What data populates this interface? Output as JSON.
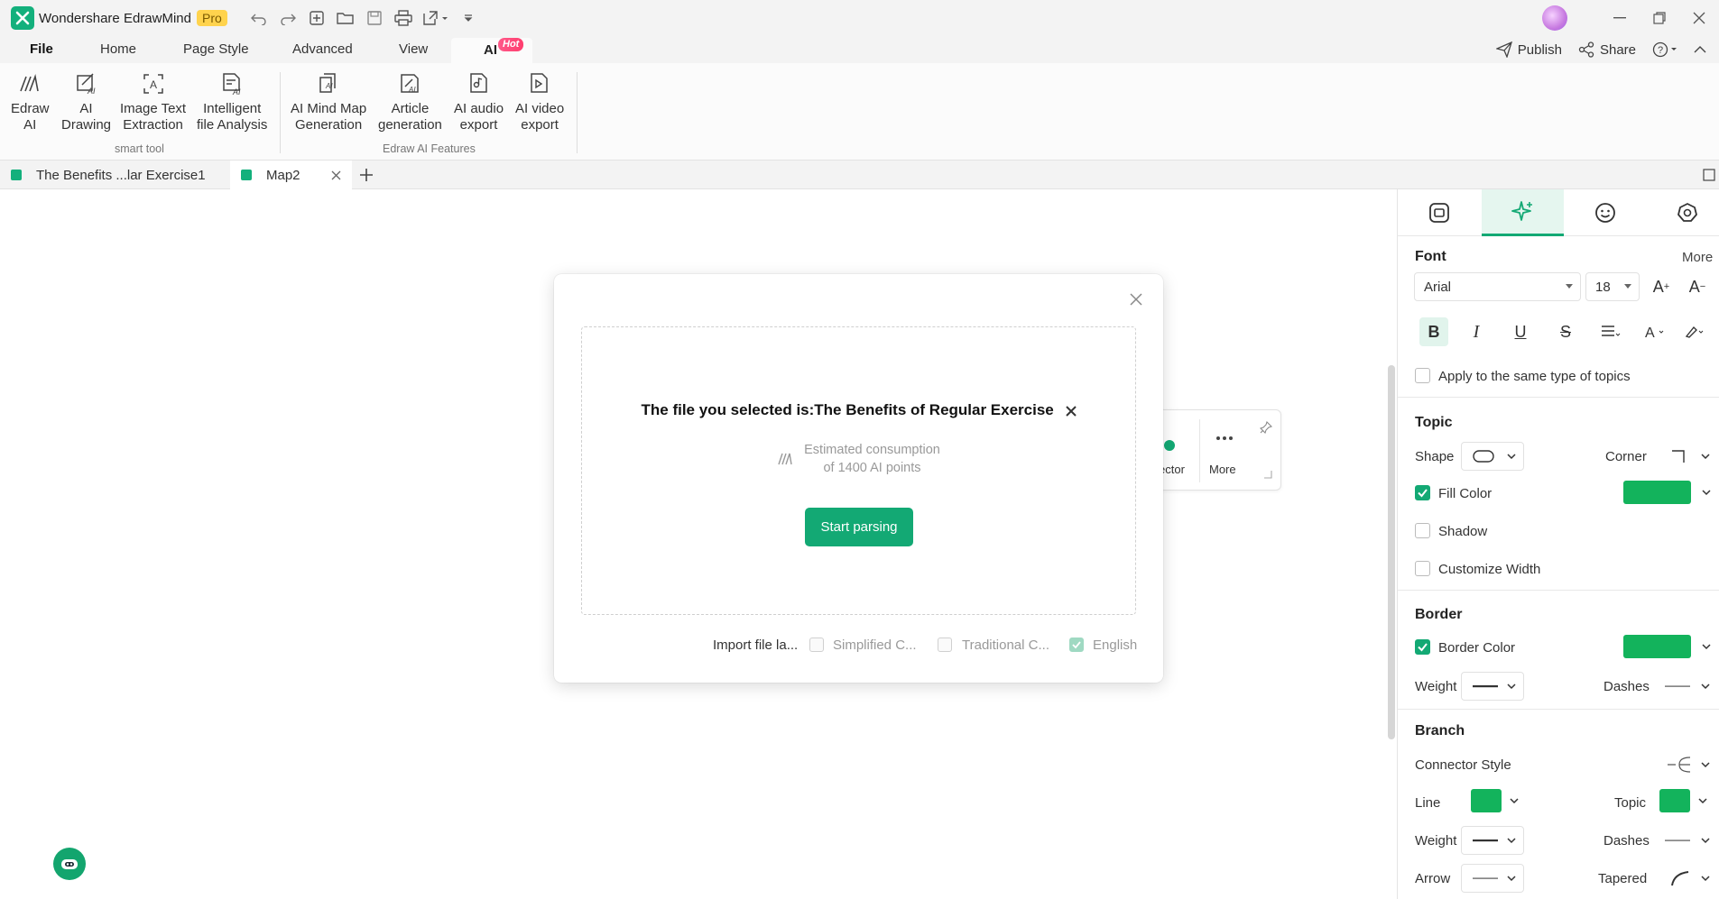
{
  "app": {
    "name": "Wondershare EdrawMind",
    "badge": "Pro"
  },
  "menu": {
    "items": [
      "File",
      "Home",
      "Page Style",
      "Advanced",
      "View"
    ],
    "ai_tab": "AI",
    "ai_badge": "Hot",
    "publish": "Publish",
    "share": "Share"
  },
  "ribbon": {
    "buttons": [
      {
        "line1": "Edraw",
        "line2": "AI",
        "icon": "edraw-ai-icon"
      },
      {
        "line1": "AI",
        "line2": "Drawing",
        "icon": "ai-drawing-icon"
      },
      {
        "line1": "Image Text",
        "line2": "Extraction",
        "icon": "image-text-icon"
      },
      {
        "line1": "Intelligent",
        "line2": "file Analysis",
        "icon": "file-analysis-icon"
      },
      {
        "line1": "AI Mind Map",
        "line2": "Generation",
        "icon": "mind-map-gen-icon"
      },
      {
        "line1": "Article",
        "line2": "generation",
        "icon": "article-icon"
      },
      {
        "line1": "AI audio",
        "line2": "export",
        "icon": "audio-export-icon"
      },
      {
        "line1": "AI video",
        "line2": "export",
        "icon": "video-export-icon"
      }
    ],
    "group1": "smart tool",
    "group2": "Edraw AI Features"
  },
  "tabs": [
    {
      "label": "The Benefits ...lar Exercise1"
    },
    {
      "label": "Map2"
    }
  ],
  "floatbar": {
    "left_label": "ector",
    "more_label": "More"
  },
  "dialog": {
    "file_label": "The file you selected is:The Benefits of Regular Exercise",
    "consume_line1": "Estimated consumption",
    "consume_line2": "of 1400 AI points",
    "start_button": "Start parsing",
    "import_label": "Import file la...",
    "options": [
      {
        "label": "Simplified C...",
        "checked": false
      },
      {
        "label": "Traditional C...",
        "checked": false
      },
      {
        "label": "English",
        "checked": true
      }
    ]
  },
  "panel": {
    "font": {
      "title": "Font",
      "more": "More",
      "family": "Arial",
      "size": "18",
      "apply_same": "Apply to the same type of topics"
    },
    "topic": {
      "title": "Topic",
      "shape": "Shape",
      "corner": "Corner",
      "fill_color": "Fill Color",
      "shadow": "Shadow",
      "customize_width": "Customize Width"
    },
    "border": {
      "title": "Border",
      "border_color": "Border Color",
      "weight": "Weight",
      "dashes": "Dashes"
    },
    "branch": {
      "title": "Branch",
      "connector_style": "Connector Style",
      "line": "Line",
      "topic": "Topic",
      "weight": "Weight",
      "dashes": "Dashes",
      "arrow": "Arrow",
      "tapered": "Tapered"
    }
  },
  "colors": {
    "accent": "#13a974",
    "fill": "#13b35c",
    "pro_badge": "#ffd34d"
  }
}
